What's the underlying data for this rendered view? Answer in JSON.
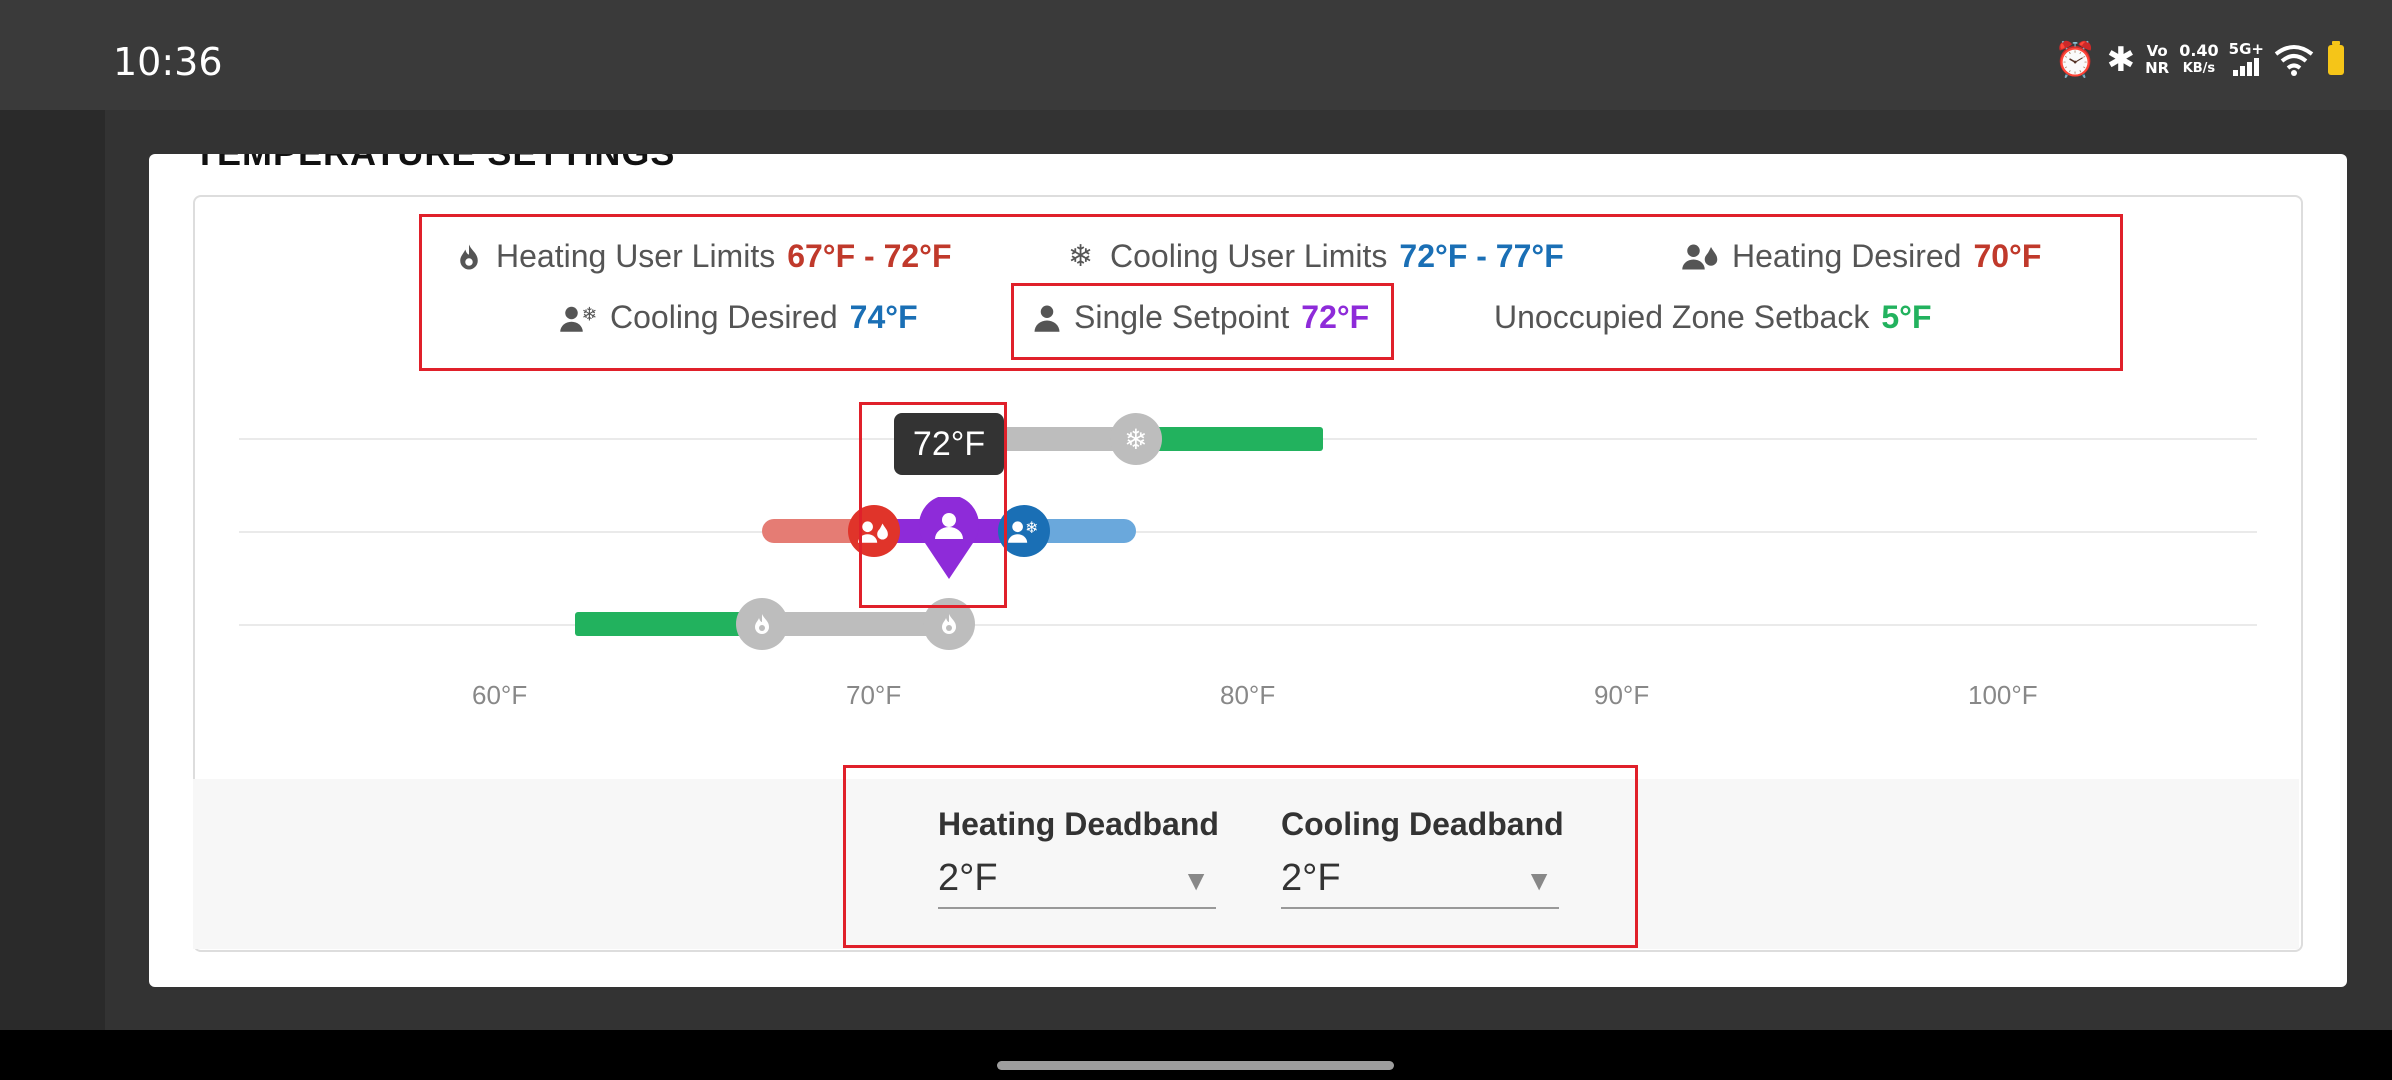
{
  "status": {
    "time": "10:36",
    "vo": "Vo",
    "nr": "NR",
    "speed": "0.40",
    "speed_unit": "KB/s",
    "network": "5G+"
  },
  "section": {
    "heading": "TEMPERATURE SETTINGS"
  },
  "legend": {
    "heating_limits_label": "Heating User Limits",
    "heating_limits_value": "67°F - 72°F",
    "cooling_limits_label": "Cooling User Limits",
    "cooling_limits_value": "72°F - 77°F",
    "heating_desired_label": "Heating Desired",
    "heating_desired_value": "70°F",
    "cooling_desired_label": "Cooling Desired",
    "cooling_desired_value": "74°F",
    "single_setpoint_label": "Single Setpoint",
    "single_setpoint_value": "72°F",
    "setback_label": "Unoccupied Zone Setback",
    "setback_value": "5°F"
  },
  "chart_data": {
    "type": "range-slider",
    "x_ticks": [
      "60°F",
      "70°F",
      "80°F",
      "90°F",
      "100°F"
    ],
    "xlim": [
      53,
      107
    ],
    "cooling_row": {
      "limit_low": 72,
      "limit_high": 77,
      "setback_end": 82
    },
    "desired_row": {
      "heating": 70,
      "cooling": 74,
      "setpoint": 72,
      "track_start": 67,
      "track_end": 77
    },
    "heating_row": {
      "limit_low": 67,
      "limit_high": 72,
      "setback_start": 62
    },
    "tooltip": "72°F",
    "colors": {
      "heating": "#e0342a",
      "cooling": "#1a6fb5",
      "setpoint": "#8e2bd9",
      "setback": "#22b25e",
      "track": "#bdbdbd"
    }
  },
  "deadband": {
    "heating_label": "Heating Deadband",
    "heating_value": "2°F",
    "cooling_label": "Cooling Deadband",
    "cooling_value": "2°F"
  }
}
